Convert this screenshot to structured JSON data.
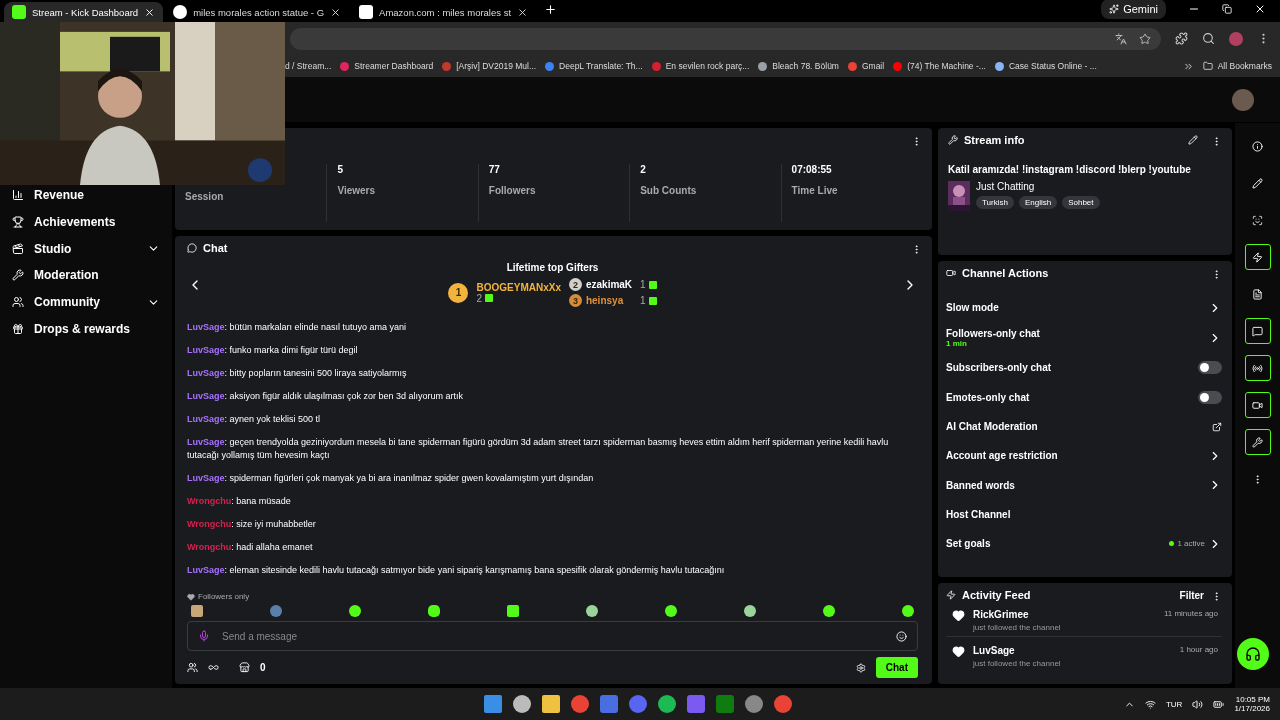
{
  "browser": {
    "tabs": [
      {
        "title": "Stream - Kick Dashboard",
        "selected": true
      },
      {
        "title": "miles morales action statue - G",
        "selected": false
      },
      {
        "title": "Amazon.com : miles morales st",
        "selected": false
      }
    ],
    "gemini": "Gemini",
    "bookmarks": [
      {
        "label": "d / Stream..."
      },
      {
        "label": "Streamer Dashboard",
        "color": "#e0245e"
      },
      {
        "label": "[Arşiv] DV2019 Mul...",
        "color": "#c0392b"
      },
      {
        "label": "DeepL Translate: Th...",
        "color": "#3b82f6"
      },
      {
        "label": "En sevilen rock parç...",
        "color": "#d6202f"
      },
      {
        "label": "Bleach 78. Bölüm",
        "color": "#9aa0a6"
      },
      {
        "label": "Gmail",
        "color": "#ea4335"
      },
      {
        "label": "(74) The Machine -...",
        "color": "#ff0000"
      },
      {
        "label": "Case Status Online - ...",
        "color": "#8ab4f8"
      }
    ],
    "all_bookmarks": "All Bookmarks"
  },
  "sidebar": {
    "items": [
      {
        "label": "Revenue",
        "expandable": false
      },
      {
        "label": "Achievements",
        "expandable": false
      },
      {
        "label": "Studio",
        "expandable": true
      },
      {
        "label": "Moderation",
        "expandable": false
      },
      {
        "label": "Community",
        "expandable": true
      },
      {
        "label": "Drops & rewards",
        "expandable": false
      }
    ]
  },
  "stats": [
    {
      "label": "Session"
    },
    {
      "value": "5",
      "label": "Viewers"
    },
    {
      "value": "77",
      "label": "Followers"
    },
    {
      "value": "2",
      "label": "Sub Counts"
    },
    {
      "value": "07:08:55",
      "label": "Time Live"
    }
  ],
  "chat": {
    "title": "Chat",
    "gifters_title": "Lifetime top Gifters",
    "gifters": [
      {
        "rank": "1",
        "name": "BOOGEYMANxXx",
        "count": "2",
        "color": "#f2b43c"
      },
      {
        "rank": "2",
        "name": "ezakimaK",
        "count": "1",
        "color": "#ffffff"
      },
      {
        "rank": "3",
        "name": "heinsya",
        "count": "1",
        "color": "#e0913a"
      }
    ],
    "messages": [
      {
        "user": "LuvSage",
        "color": "#a970ff",
        "text": ": bütün markaları elinde nasıl tutuyo ama yani"
      },
      {
        "user": "LuvSage",
        "color": "#a970ff",
        "text": ": funko marka dimi figür türü degil"
      },
      {
        "user": "LuvSage",
        "color": "#a970ff",
        "text": ": bitty popların tanesini 500 liraya satiyolarmış"
      },
      {
        "user": "LuvSage",
        "color": "#a970ff",
        "text": ": aksiyon figür aldık ulaşılması çok zor ben 3d alıyorum artık"
      },
      {
        "user": "LuvSage",
        "color": "#a970ff",
        "text": ": aynen yok teklisi 500 tl"
      },
      {
        "user": "LuvSage",
        "color": "#a970ff",
        "text": ": geçen trendyolda geziniyordum mesela bi tane spiderman figürü gördüm 3d adam street tarzı spiderman basmış heves ettim aldım herif spiderman yerine kedili havlu tutacağı yollamış tüm hevesim kaçtı"
      },
      {
        "user": "LuvSage",
        "color": "#a970ff",
        "text": ": spiderman figürleri çok manyak ya bi ara inanılmaz spider gwen kovalamıştım yurt dışından"
      },
      {
        "user": "Wrongchu",
        "color": "#d6204f",
        "text": ": bana müsade"
      },
      {
        "user": "Wrongchu",
        "color": "#d6204f",
        "text": ": size iyi muhabbetler"
      },
      {
        "user": "Wrongchu",
        "color": "#d6204f",
        "text": ": hadi allaha emanet"
      },
      {
        "user": "LuvSage",
        "color": "#a970ff",
        "text": ": eleman sitesinde kedili havlu tutacağı satmıyor bide yani sipariş karışmamış bana spesifik olarak göndermiş havlu tutacağını"
      }
    ],
    "mode": "Followers only",
    "placeholder": "Send a message",
    "store_count": "0",
    "send": "Chat"
  },
  "stream_info": {
    "title": "Stream info",
    "stream_title": "Katil aramızda! !instagram !discord !blerp !youtube",
    "category": "Just Chatting",
    "tags": [
      "Turkish",
      "English",
      "Sohbet"
    ]
  },
  "channel_actions": {
    "title": "Channel Actions",
    "items": [
      {
        "label": "Slow mode",
        "kind": "arrow"
      },
      {
        "label": "Followers-only chat",
        "kind": "arrow",
        "detail": "1 min"
      },
      {
        "label": "Subscribers-only chat",
        "kind": "toggle",
        "on": false
      },
      {
        "label": "Emotes-only chat",
        "kind": "toggle",
        "on": false
      },
      {
        "label": "AI Chat Moderation",
        "kind": "external"
      },
      {
        "label": "Account age restriction",
        "kind": "arrow"
      },
      {
        "label": "Banned words",
        "kind": "arrow"
      },
      {
        "label": "Host Channel",
        "kind": "plain"
      },
      {
        "label": "Set goals",
        "kind": "status",
        "status": "1 active"
      }
    ]
  },
  "activity_feed": {
    "title": "Activity Feed",
    "filter": "Filter",
    "items": [
      {
        "name": "RickGrimee",
        "time": "11 minutes ago",
        "text": "just followed the channel"
      },
      {
        "name": "LuvSage",
        "time": "1 hour ago",
        "text": "just followed the channel"
      }
    ]
  },
  "rail": [
    {
      "kind": "info",
      "active": false
    },
    {
      "kind": "edit",
      "active": false
    },
    {
      "kind": "capture",
      "active": false
    },
    {
      "kind": "zap",
      "active": true
    },
    {
      "kind": "notes",
      "active": false
    },
    {
      "kind": "chat",
      "active": true
    },
    {
      "kind": "broadcast",
      "active": true
    },
    {
      "kind": "video",
      "active": true
    },
    {
      "kind": "wrench",
      "active": true
    },
    {
      "kind": "dots",
      "active": false
    }
  ],
  "taskbar": {
    "language": "TUR",
    "time": "10:05 PM",
    "date": "1/17/2026"
  }
}
